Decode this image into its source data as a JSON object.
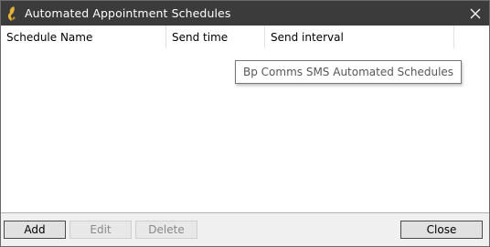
{
  "window": {
    "title": "Automated Appointment Schedules"
  },
  "listview": {
    "columns": [
      "Schedule Name",
      "Send time",
      "Send interval"
    ],
    "rows": []
  },
  "tooltip": {
    "text": "Bp Comms SMS Automated Schedules"
  },
  "buttons": {
    "add": "Add",
    "edit": "Edit",
    "delete": "Delete",
    "close": "Close"
  },
  "colors": {
    "titlebar": "#3b3b3b",
    "window_bg": "#f0f0f0",
    "list_bg": "#ffffff"
  },
  "icons": {
    "app": "app-logo-icon",
    "close": "close-icon"
  }
}
